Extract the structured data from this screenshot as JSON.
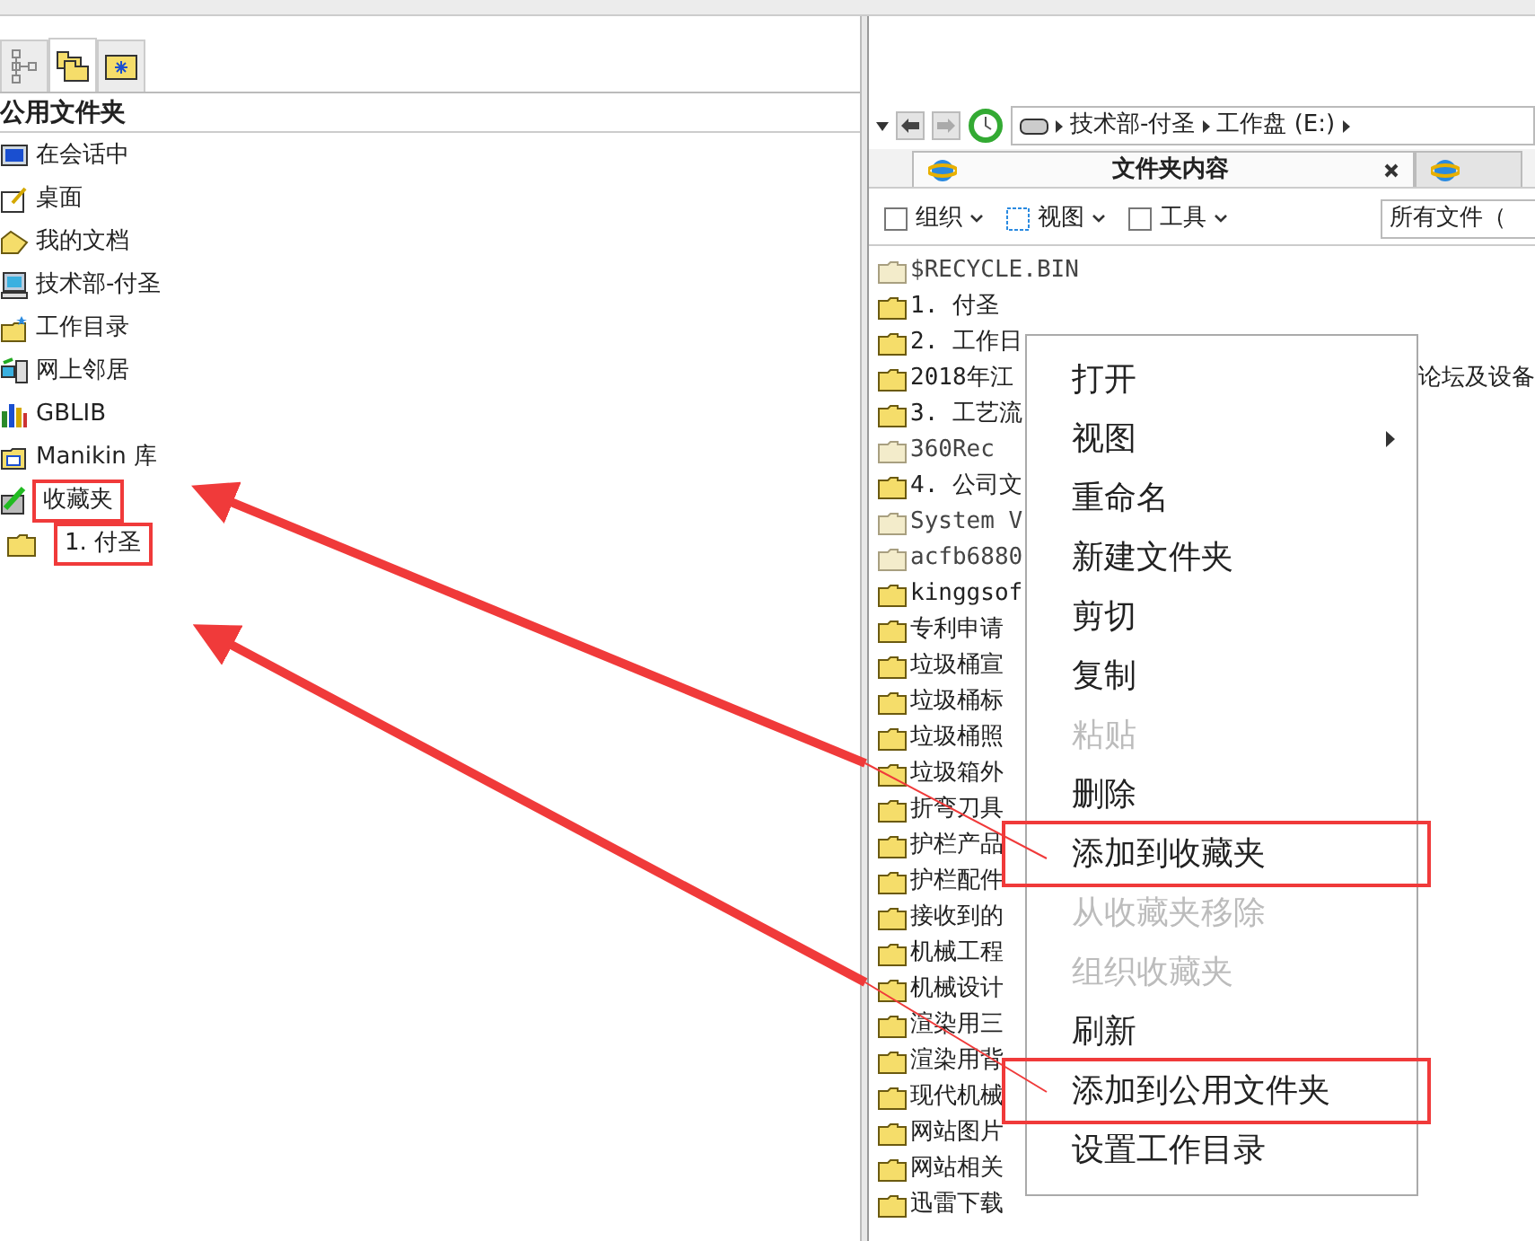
{
  "left_tabs": [
    {
      "kind": "tree",
      "selected": false
    },
    {
      "kind": "folders",
      "selected": true
    },
    {
      "kind": "favorites",
      "selected": false
    }
  ],
  "tree": {
    "title": "公用文件夹",
    "items": [
      {
        "label": "在会话中",
        "kind": "monitor",
        "highlighted": false
      },
      {
        "label": "桌面",
        "kind": "desktop",
        "highlighted": false
      },
      {
        "label": "我的文档",
        "kind": "documents",
        "highlighted": false
      },
      {
        "label": "技术部-付圣",
        "kind": "computer",
        "highlighted": false
      },
      {
        "label": "工作目录",
        "kind": "workdir",
        "highlighted": false
      },
      {
        "label": "网上邻居",
        "kind": "network",
        "highlighted": false
      },
      {
        "label": "GBLIB",
        "kind": "library",
        "highlighted": false
      },
      {
        "label": "Manikin 库",
        "kind": "manikin",
        "highlighted": false
      },
      {
        "label": "收藏夹",
        "kind": "favorites",
        "highlighted": true,
        "children": [
          {
            "label": "1. 付圣",
            "kind": "folder",
            "highlighted": true
          }
        ]
      }
    ]
  },
  "address": {
    "segments": [
      "技术部-付圣",
      "工作盘 (E:)"
    ]
  },
  "tabs": [
    {
      "label": "文件夹内容",
      "selected": true
    },
    {
      "selected": false
    }
  ],
  "toolbar": [
    "组织",
    "视图",
    "工具"
  ],
  "filter": "所有文件（",
  "files": [
    {
      "name": "$RECYCLE.BIN",
      "kind": "system"
    },
    {
      "name": "1. 付圣",
      "kind": "folder"
    },
    {
      "name": "2. 工作日",
      "kind": "folder"
    },
    {
      "name": "2018年江",
      "kind": "folder",
      "column_2": "论坛及设备"
    },
    {
      "name": "3. 工艺流",
      "kind": "folder"
    },
    {
      "name": "360Rec",
      "kind": "system"
    },
    {
      "name": "4. 公司文",
      "kind": "folder"
    },
    {
      "name": "System V",
      "kind": "system"
    },
    {
      "name": "acfb6880",
      "kind": "system"
    },
    {
      "name": "kinggsof",
      "kind": "folder"
    },
    {
      "name": "专利申请",
      "kind": "folder"
    },
    {
      "name": "垃圾桶宣",
      "kind": "folder"
    },
    {
      "name": "垃圾桶标",
      "kind": "folder"
    },
    {
      "name": "垃圾桶照",
      "kind": "folder"
    },
    {
      "name": "垃圾箱外",
      "kind": "folder"
    },
    {
      "name": "折弯刀具",
      "kind": "folder"
    },
    {
      "name": "护栏产品",
      "kind": "folder"
    },
    {
      "name": "护栏配件",
      "kind": "folder"
    },
    {
      "name": "接收到的",
      "kind": "folder"
    },
    {
      "name": "机械工程",
      "kind": "folder"
    },
    {
      "name": "机械设计",
      "kind": "folder"
    },
    {
      "name": "渲染用三",
      "kind": "folder"
    },
    {
      "name": "渲染用背",
      "kind": "folder"
    },
    {
      "name": "现代机械",
      "kind": "folder"
    },
    {
      "name": "网站图片",
      "kind": "folder"
    },
    {
      "name": "网站相关",
      "kind": "folder"
    },
    {
      "name": "迅雷下载",
      "kind": "folder"
    }
  ],
  "context_menu": [
    {
      "label": "打开",
      "disabled": false,
      "highlighted": false,
      "submenu": false
    },
    {
      "label": "视图",
      "disabled": false,
      "highlighted": false,
      "submenu": true
    },
    {
      "label": "重命名",
      "disabled": false,
      "highlighted": false,
      "submenu": false
    },
    {
      "label": "新建文件夹",
      "disabled": false,
      "highlighted": false,
      "submenu": false
    },
    {
      "label": "剪切",
      "disabled": false,
      "highlighted": false,
      "submenu": false
    },
    {
      "label": "复制",
      "disabled": false,
      "highlighted": false,
      "submenu": false
    },
    {
      "label": "粘贴",
      "disabled": true,
      "highlighted": false,
      "submenu": false
    },
    {
      "label": "删除",
      "disabled": false,
      "highlighted": false,
      "submenu": false
    },
    {
      "label": "添加到收藏夹",
      "disabled": false,
      "highlighted": true,
      "submenu": false
    },
    {
      "label": "从收藏夹移除",
      "disabled": true,
      "highlighted": false,
      "submenu": false
    },
    {
      "label": "组织收藏夹",
      "disabled": true,
      "highlighted": false,
      "submenu": false
    },
    {
      "label": "刷新",
      "disabled": false,
      "highlighted": false,
      "submenu": false
    },
    {
      "label": "添加到公用文件夹",
      "disabled": false,
      "highlighted": true,
      "submenu": false
    },
    {
      "label": "设置工作目录",
      "disabled": false,
      "highlighted": false,
      "submenu": false
    }
  ]
}
